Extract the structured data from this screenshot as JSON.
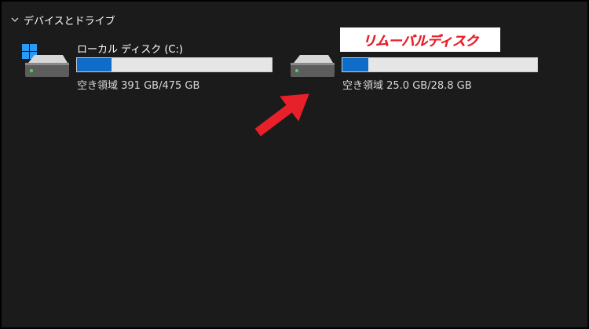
{
  "section": {
    "title": "デバイスとドライブ",
    "expand_icon": "chevron-down-icon"
  },
  "drives": [
    {
      "label": "ローカル ディスク (C:)",
      "free_text": "空き領域 391 GB/475 GB",
      "used_fraction": 0.177,
      "icon": "windows-logo-icon"
    },
    {
      "label": "",
      "free_text": "空き領域 25.0 GB/28.8 GB",
      "used_fraction": 0.132,
      "icon": "removable-drive-icon"
    }
  ],
  "annotation": {
    "text": "リムーバルディスク",
    "color": "#e8202a",
    "arrow_color": "#e8202a"
  },
  "colors": {
    "background": "#1b1b1b",
    "accent": "#0f6cc9",
    "bar_track": "#e6e6e6"
  }
}
